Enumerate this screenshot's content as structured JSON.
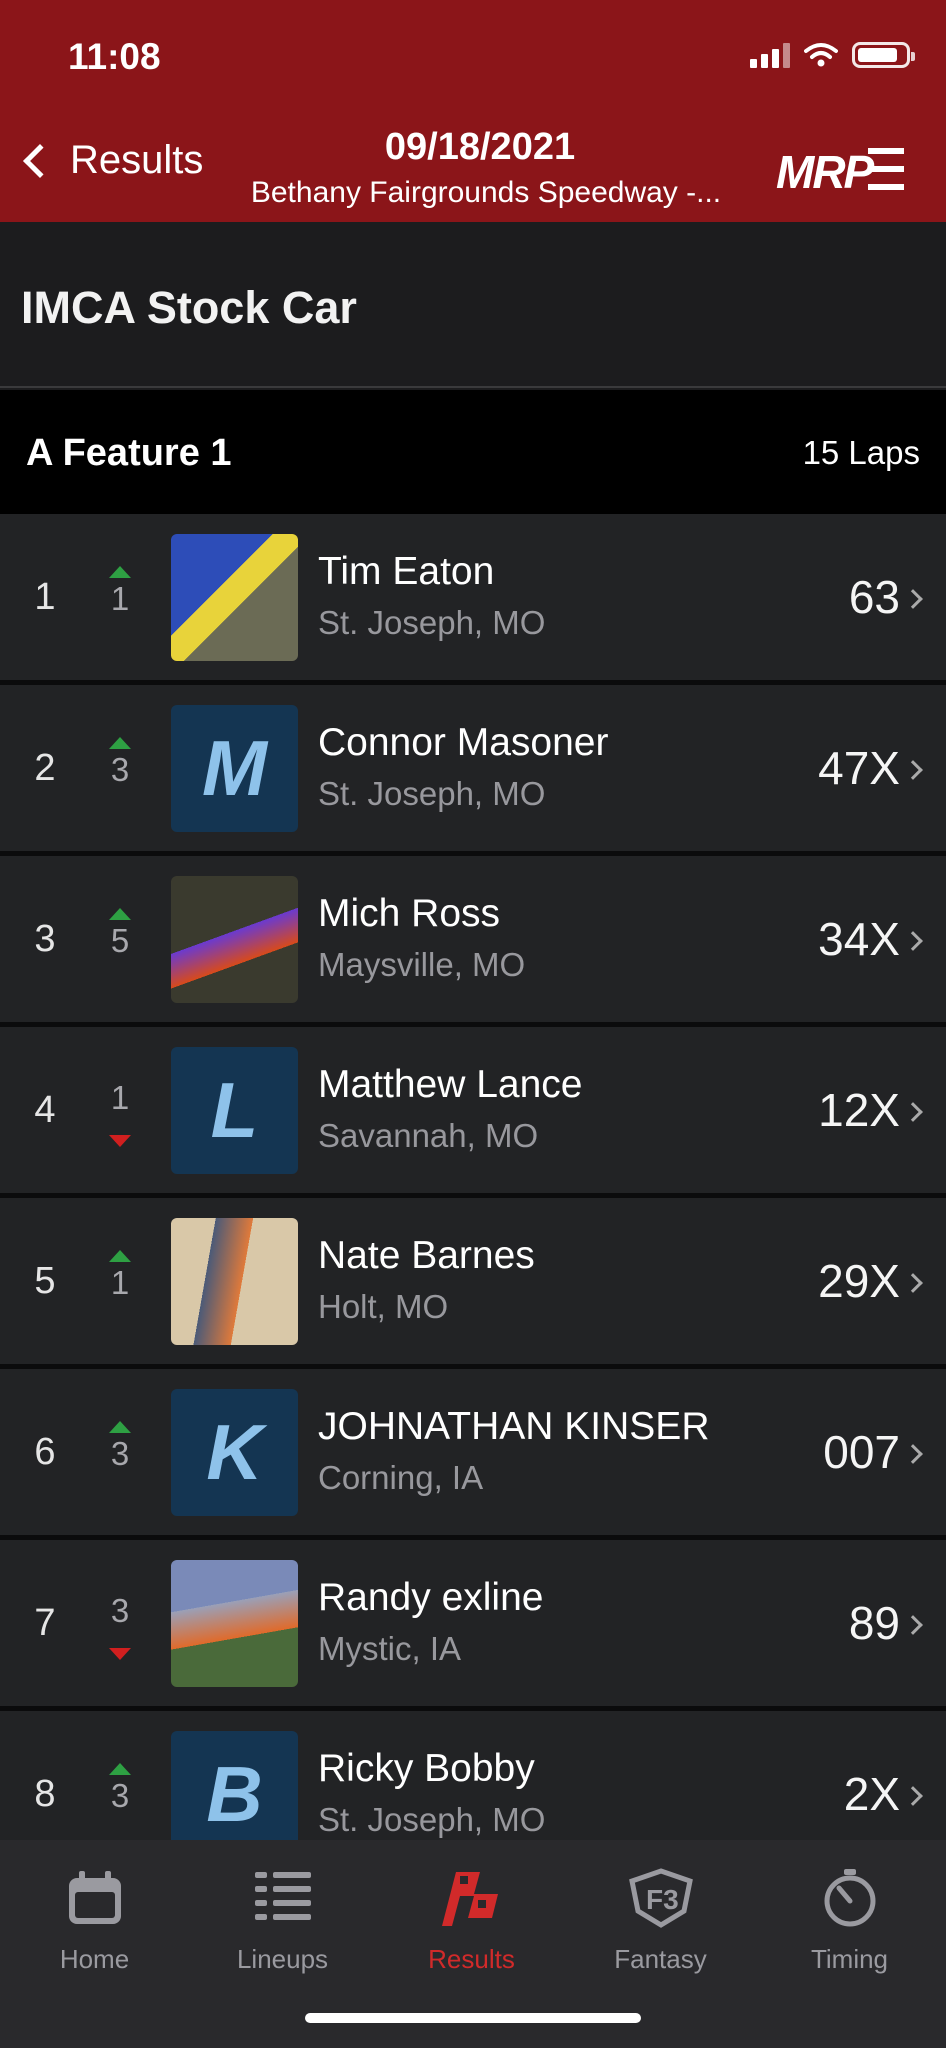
{
  "status_bar": {
    "time": "11:08"
  },
  "nav": {
    "back_label": "Results",
    "title": "09/18/2021",
    "subtitle": "Bethany Fairgrounds Speedway -...",
    "logo_text": "MRP"
  },
  "class_title": "IMCA Stock Car",
  "event": {
    "name": "A Feature 1",
    "laps": "15 Laps"
  },
  "results": [
    {
      "pos": "1",
      "move": "1",
      "direction": "up",
      "name": "Tim Eaton",
      "location": "St. Joseph, MO",
      "car": "63",
      "avatar": "photo"
    },
    {
      "pos": "2",
      "move": "3",
      "direction": "up",
      "name": "Connor Masoner",
      "location": "St. Joseph, MO",
      "car": "47X",
      "avatar": "M"
    },
    {
      "pos": "3",
      "move": "5",
      "direction": "up",
      "name": "Mich Ross",
      "location": "Maysville, MO",
      "car": "34X",
      "avatar": "photo"
    },
    {
      "pos": "4",
      "move": "1",
      "direction": "down",
      "name": "Matthew Lance",
      "location": "Savannah, MO",
      "car": "12X",
      "avatar": "L"
    },
    {
      "pos": "5",
      "move": "1",
      "direction": "up",
      "name": "Nate Barnes",
      "location": "Holt, MO",
      "car": "29X",
      "avatar": "photo"
    },
    {
      "pos": "6",
      "move": "3",
      "direction": "up",
      "name": "JOHNATHAN KINSER",
      "location": "Corning, IA",
      "car": "007",
      "avatar": "K"
    },
    {
      "pos": "7",
      "move": "3",
      "direction": "down",
      "name": "Randy exline",
      "location": "Mystic, IA",
      "car": "89",
      "avatar": "photo"
    },
    {
      "pos": "8",
      "move": "3",
      "direction": "up",
      "name": "Ricky Bobby",
      "location": "St. Joseph, MO",
      "car": "2X",
      "avatar": "B"
    }
  ],
  "tabs": [
    {
      "label": "Home",
      "icon": "calendar-icon",
      "active": false
    },
    {
      "label": "Lineups",
      "icon": "list-icon",
      "active": false
    },
    {
      "label": "Results",
      "icon": "checkered-flag-icon",
      "active": true
    },
    {
      "label": "Fantasy",
      "icon": "fantasy-shield-icon",
      "active": false
    },
    {
      "label": "Timing",
      "icon": "stopwatch-icon",
      "active": false
    }
  ],
  "colors": {
    "header": "#8b1519",
    "active_tab": "#d12a2a",
    "up": "#2ea043",
    "down": "#d11f1f"
  }
}
